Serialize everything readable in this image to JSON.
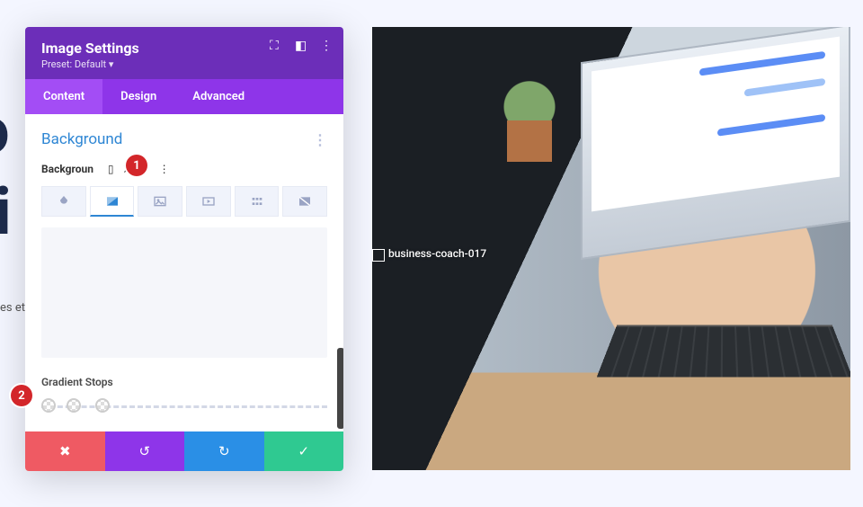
{
  "background_page": {
    "big1": "o",
    "big2": "fi",
    "small": "es et a"
  },
  "panel": {
    "title": "Image Settings",
    "preset_label": "Preset: ",
    "preset_value": "Default",
    "tabs": [
      "Content",
      "Design",
      "Advanced"
    ],
    "active_tab": "Content",
    "section_title": "Background",
    "background_label": "Backgroun",
    "background_types": [
      "color",
      "gradient",
      "image",
      "video",
      "pattern",
      "mask"
    ],
    "background_type_active": "gradient",
    "gradient_stops_label": "Gradient Stops",
    "gradient_stops": [
      {
        "position": 0
      },
      {
        "position": 10
      },
      {
        "position": 20
      }
    ],
    "footer_buttons": [
      "cancel",
      "undo",
      "redo",
      "save"
    ]
  },
  "image_module": {
    "overlay_label": "business-coach-017"
  },
  "annotations": [
    "1",
    "2"
  ]
}
